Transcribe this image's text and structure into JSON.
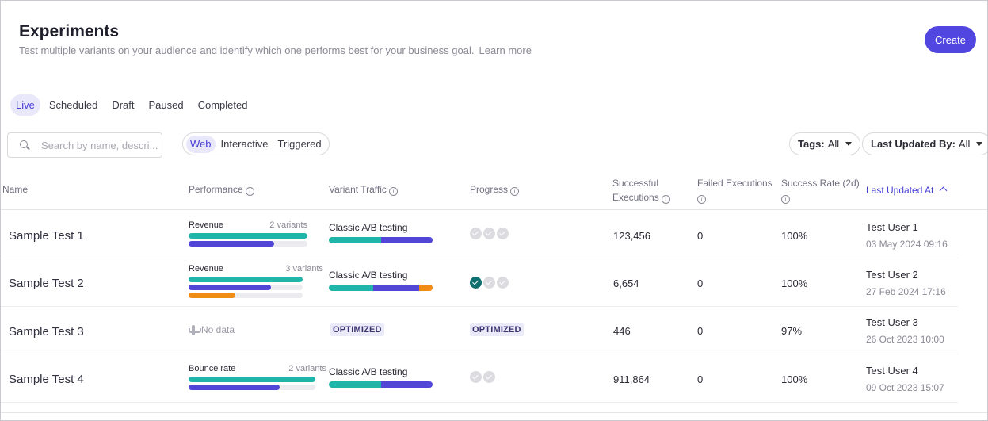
{
  "header": {
    "title": "Experiments",
    "subtitle": "Test multiple variants on your audience and identify which one performs best for your business goal.",
    "learn_more": "Learn more",
    "create_label": "Create"
  },
  "status_tabs": [
    "Live",
    "Scheduled",
    "Draft",
    "Paused",
    "Completed"
  ],
  "search": {
    "placeholder": "Search by name, descri..."
  },
  "type_tabs": [
    "Web",
    "Interactive",
    "Triggered"
  ],
  "filters": {
    "tags_label": "Tags:",
    "tags_value": "All",
    "updated_label": "Last Updated By:",
    "updated_value": "All"
  },
  "columns": {
    "name": "Name",
    "performance": "Performance",
    "variant_traffic": "Variant Traffic",
    "progress": "Progress",
    "successful_1": "Successful",
    "successful_2": "Executions",
    "failed": "Failed Executions",
    "success_rate": "Success Rate (2d)",
    "last_updated": "Last Updated At"
  },
  "colors": {
    "teal": "#1fb5a8",
    "purple": "#5146d6",
    "orange": "#f08c16",
    "accent": "#5146e0"
  },
  "rows": [
    {
      "name": "Sample Test 1",
      "perf_metric": "Revenue",
      "perf_variants": "2 variants",
      "perf_bars": [
        {
          "fill": 1.0,
          "color": "teal"
        },
        {
          "fill": 0.72,
          "color": "purple"
        }
      ],
      "traffic_label": "Classic A/B testing",
      "traffic": [
        {
          "share": 0.5,
          "color": "teal"
        },
        {
          "share": 0.5,
          "color": "purple"
        }
      ],
      "progress": [
        "pending",
        "pending",
        "pending"
      ],
      "successful": "123,456",
      "failed": "0",
      "success_rate": "100%",
      "user": "Test User 1",
      "date": "03 May 2024 09:16"
    },
    {
      "name": "Sample Test 2",
      "perf_metric": "Revenue",
      "perf_variants": "3 variants",
      "perf_bars": [
        {
          "fill": 1.0,
          "color": "teal"
        },
        {
          "fill": 0.72,
          "color": "purple"
        },
        {
          "fill": 0.41,
          "color": "orange"
        }
      ],
      "traffic_label": "Classic A/B testing",
      "traffic": [
        {
          "share": 0.43,
          "color": "teal"
        },
        {
          "share": 0.44,
          "color": "purple"
        },
        {
          "share": 0.13,
          "color": "orange"
        }
      ],
      "progress": [
        "done",
        "pending",
        "pending"
      ],
      "successful": "6,654",
      "failed": "0",
      "success_rate": "100%",
      "user": "Test User 2",
      "date": "27 Feb 2024 17:16"
    },
    {
      "name": "Sample Test 3",
      "no_data": "No data",
      "traffic_badge": "OPTIMIZED",
      "progress_badge": "OPTIMIZED",
      "successful": "446",
      "failed": "0",
      "success_rate": "97%",
      "user": "Test User 3",
      "date": "26 Oct 2023 10:00"
    },
    {
      "name": "Sample Test 4",
      "perf_metric": "Bounce rate",
      "perf_variants": "2 variants",
      "perf_bars": [
        {
          "fill": 1.0,
          "color": "teal"
        },
        {
          "fill": 0.72,
          "color": "purple"
        }
      ],
      "traffic_label": "Classic A/B testing",
      "traffic": [
        {
          "share": 0.5,
          "color": "teal"
        },
        {
          "share": 0.5,
          "color": "purple"
        }
      ],
      "progress": [
        "pending",
        "pending"
      ],
      "successful": "911,864",
      "failed": "0",
      "success_rate": "100%",
      "user": "Test User 4",
      "date": "09 Oct 2023 15:07"
    }
  ]
}
